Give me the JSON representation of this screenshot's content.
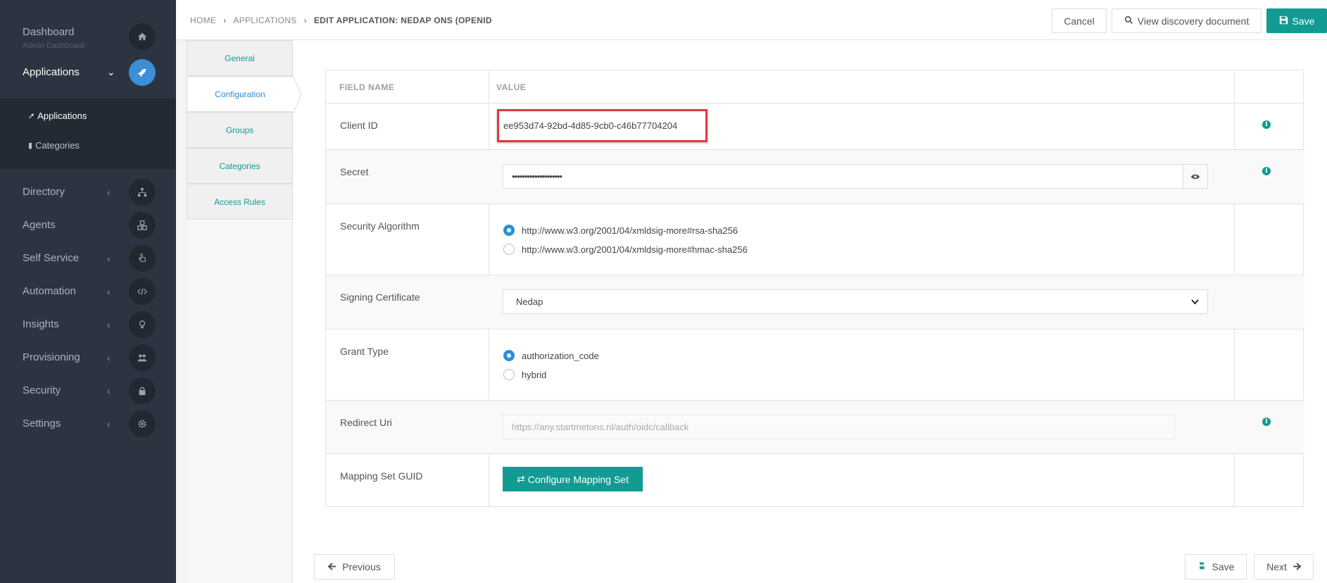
{
  "sidebar": {
    "dashboard": {
      "label": "Dashboard",
      "sublabel": "Admin Dashboard"
    },
    "applications": {
      "label": "Applications"
    },
    "submenu": [
      {
        "label": "Applications"
      },
      {
        "label": "Categories"
      }
    ],
    "items": [
      {
        "label": "Directory",
        "icon": "sitemap-icon"
      },
      {
        "label": "Agents",
        "icon": "cubes-icon"
      },
      {
        "label": "Self Service",
        "icon": "hand-pointer-icon"
      },
      {
        "label": "Automation",
        "icon": "code-icon"
      },
      {
        "label": "Insights",
        "icon": "lightbulb-icon"
      },
      {
        "label": "Provisioning",
        "icon": "users-icon"
      },
      {
        "label": "Security",
        "icon": "lock-icon"
      },
      {
        "label": "Settings",
        "icon": "gear-icon"
      }
    ]
  },
  "breadcrumb": {
    "home": "HOME",
    "applications": "APPLICATIONS",
    "current": "EDIT APPLICATION: NEDAP ONS (OPENID"
  },
  "toolbar": {
    "cancel": "Cancel",
    "discovery": "View discovery document",
    "save": "Save"
  },
  "tabs": [
    {
      "label": "General"
    },
    {
      "label": "Configuration"
    },
    {
      "label": "Groups"
    },
    {
      "label": "Categories"
    },
    {
      "label": "Access Rules"
    }
  ],
  "table": {
    "header_field": "FIELD NAME",
    "header_value": "VALUE",
    "client_id": {
      "label": "Client ID",
      "value": "ee953d74-92bd-4d85-9cb0-c46b77704204"
    },
    "secret": {
      "label": "Secret",
      "value": "••••••••••••••••••••"
    },
    "security_algorithm": {
      "label": "Security Algorithm",
      "options": [
        {
          "label": "http://www.w3.org/2001/04/xmldsig-more#rsa-sha256",
          "checked": true
        },
        {
          "label": "http://www.w3.org/2001/04/xmldsig-more#hmac-sha256",
          "checked": false
        }
      ]
    },
    "signing_certificate": {
      "label": "Signing Certificate",
      "value": "Nedap"
    },
    "grant_type": {
      "label": "Grant Type",
      "options": [
        {
          "label": "authorization_code",
          "checked": true
        },
        {
          "label": "hybrid",
          "checked": false
        }
      ]
    },
    "redirect_uri": {
      "label": "Redirect Uri",
      "placeholder": "https://any.startmetons.nl/auth/oidc/callback"
    },
    "mapping_set": {
      "label": "Mapping Set GUID",
      "button": "Configure Mapping Set"
    }
  },
  "footer": {
    "previous": "Previous",
    "save": "Save",
    "next": "Next"
  },
  "colors": {
    "accent": "#129b93",
    "sidebar_bg": "#2b3440",
    "active_blue": "#2b8fd6",
    "highlight_box": "#e0393e"
  }
}
